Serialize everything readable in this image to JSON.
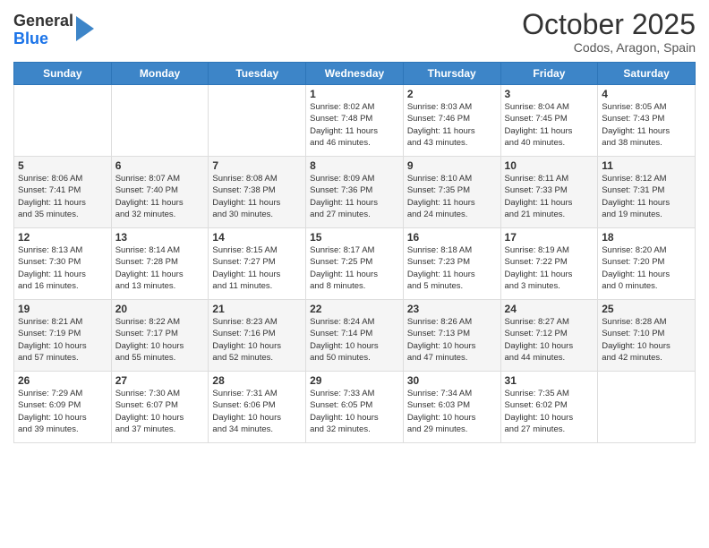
{
  "header": {
    "logo": {
      "general": "General",
      "blue": "Blue"
    },
    "title": "October 2025",
    "location": "Codos, Aragon, Spain"
  },
  "weekdays": [
    "Sunday",
    "Monday",
    "Tuesday",
    "Wednesday",
    "Thursday",
    "Friday",
    "Saturday"
  ],
  "weeks": [
    [
      {
        "day": null,
        "info": null
      },
      {
        "day": null,
        "info": null
      },
      {
        "day": null,
        "info": null
      },
      {
        "day": "1",
        "info": "Sunrise: 8:02 AM\nSunset: 7:48 PM\nDaylight: 11 hours\nand 46 minutes."
      },
      {
        "day": "2",
        "info": "Sunrise: 8:03 AM\nSunset: 7:46 PM\nDaylight: 11 hours\nand 43 minutes."
      },
      {
        "day": "3",
        "info": "Sunrise: 8:04 AM\nSunset: 7:45 PM\nDaylight: 11 hours\nand 40 minutes."
      },
      {
        "day": "4",
        "info": "Sunrise: 8:05 AM\nSunset: 7:43 PM\nDaylight: 11 hours\nand 38 minutes."
      }
    ],
    [
      {
        "day": "5",
        "info": "Sunrise: 8:06 AM\nSunset: 7:41 PM\nDaylight: 11 hours\nand 35 minutes."
      },
      {
        "day": "6",
        "info": "Sunrise: 8:07 AM\nSunset: 7:40 PM\nDaylight: 11 hours\nand 32 minutes."
      },
      {
        "day": "7",
        "info": "Sunrise: 8:08 AM\nSunset: 7:38 PM\nDaylight: 11 hours\nand 30 minutes."
      },
      {
        "day": "8",
        "info": "Sunrise: 8:09 AM\nSunset: 7:36 PM\nDaylight: 11 hours\nand 27 minutes."
      },
      {
        "day": "9",
        "info": "Sunrise: 8:10 AM\nSunset: 7:35 PM\nDaylight: 11 hours\nand 24 minutes."
      },
      {
        "day": "10",
        "info": "Sunrise: 8:11 AM\nSunset: 7:33 PM\nDaylight: 11 hours\nand 21 minutes."
      },
      {
        "day": "11",
        "info": "Sunrise: 8:12 AM\nSunset: 7:31 PM\nDaylight: 11 hours\nand 19 minutes."
      }
    ],
    [
      {
        "day": "12",
        "info": "Sunrise: 8:13 AM\nSunset: 7:30 PM\nDaylight: 11 hours\nand 16 minutes."
      },
      {
        "day": "13",
        "info": "Sunrise: 8:14 AM\nSunset: 7:28 PM\nDaylight: 11 hours\nand 13 minutes."
      },
      {
        "day": "14",
        "info": "Sunrise: 8:15 AM\nSunset: 7:27 PM\nDaylight: 11 hours\nand 11 minutes."
      },
      {
        "day": "15",
        "info": "Sunrise: 8:17 AM\nSunset: 7:25 PM\nDaylight: 11 hours\nand 8 minutes."
      },
      {
        "day": "16",
        "info": "Sunrise: 8:18 AM\nSunset: 7:23 PM\nDaylight: 11 hours\nand 5 minutes."
      },
      {
        "day": "17",
        "info": "Sunrise: 8:19 AM\nSunset: 7:22 PM\nDaylight: 11 hours\nand 3 minutes."
      },
      {
        "day": "18",
        "info": "Sunrise: 8:20 AM\nSunset: 7:20 PM\nDaylight: 11 hours\nand 0 minutes."
      }
    ],
    [
      {
        "day": "19",
        "info": "Sunrise: 8:21 AM\nSunset: 7:19 PM\nDaylight: 10 hours\nand 57 minutes."
      },
      {
        "day": "20",
        "info": "Sunrise: 8:22 AM\nSunset: 7:17 PM\nDaylight: 10 hours\nand 55 minutes."
      },
      {
        "day": "21",
        "info": "Sunrise: 8:23 AM\nSunset: 7:16 PM\nDaylight: 10 hours\nand 52 minutes."
      },
      {
        "day": "22",
        "info": "Sunrise: 8:24 AM\nSunset: 7:14 PM\nDaylight: 10 hours\nand 50 minutes."
      },
      {
        "day": "23",
        "info": "Sunrise: 8:26 AM\nSunset: 7:13 PM\nDaylight: 10 hours\nand 47 minutes."
      },
      {
        "day": "24",
        "info": "Sunrise: 8:27 AM\nSunset: 7:12 PM\nDaylight: 10 hours\nand 44 minutes."
      },
      {
        "day": "25",
        "info": "Sunrise: 8:28 AM\nSunset: 7:10 PM\nDaylight: 10 hours\nand 42 minutes."
      }
    ],
    [
      {
        "day": "26",
        "info": "Sunrise: 7:29 AM\nSunset: 6:09 PM\nDaylight: 10 hours\nand 39 minutes."
      },
      {
        "day": "27",
        "info": "Sunrise: 7:30 AM\nSunset: 6:07 PM\nDaylight: 10 hours\nand 37 minutes."
      },
      {
        "day": "28",
        "info": "Sunrise: 7:31 AM\nSunset: 6:06 PM\nDaylight: 10 hours\nand 34 minutes."
      },
      {
        "day": "29",
        "info": "Sunrise: 7:33 AM\nSunset: 6:05 PM\nDaylight: 10 hours\nand 32 minutes."
      },
      {
        "day": "30",
        "info": "Sunrise: 7:34 AM\nSunset: 6:03 PM\nDaylight: 10 hours\nand 29 minutes."
      },
      {
        "day": "31",
        "info": "Sunrise: 7:35 AM\nSunset: 6:02 PM\nDaylight: 10 hours\nand 27 minutes."
      },
      {
        "day": null,
        "info": null
      }
    ]
  ]
}
